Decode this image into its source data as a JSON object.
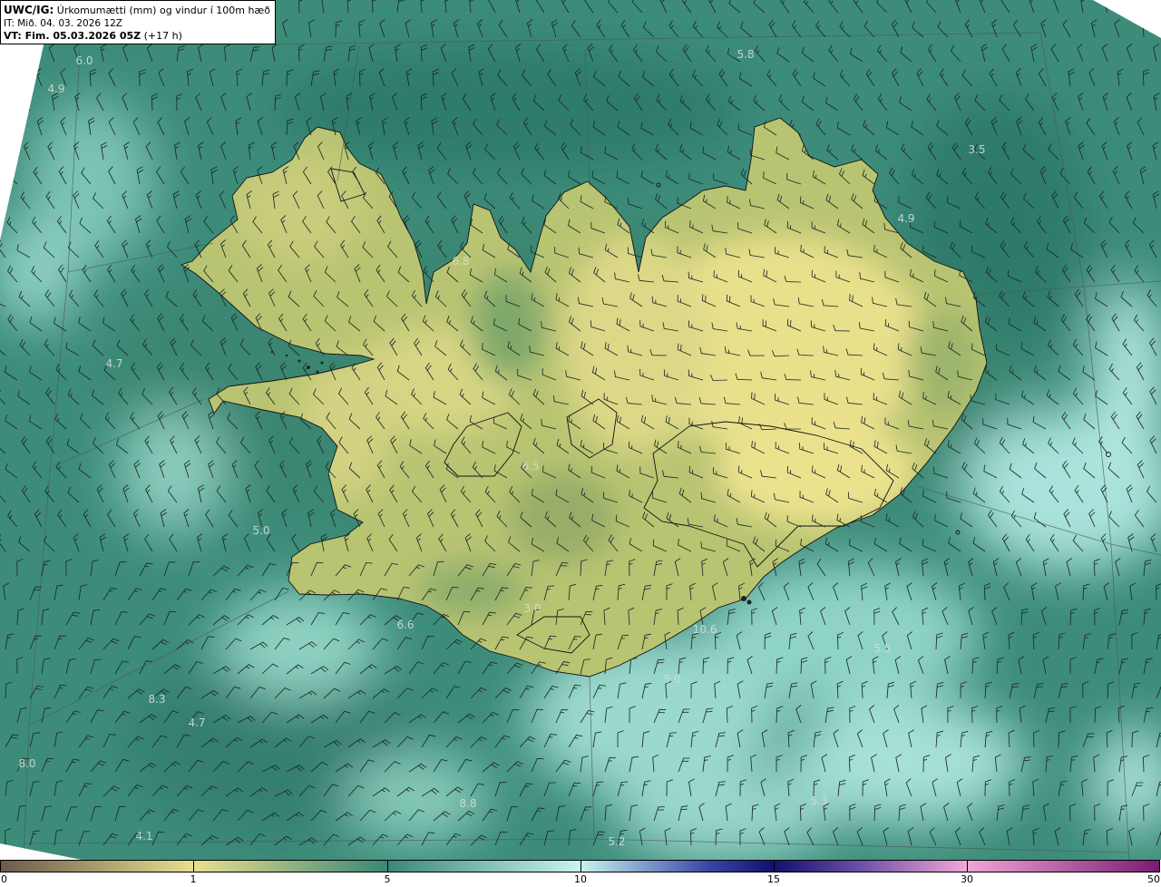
{
  "header": {
    "model": "UWC/IG:",
    "title": "Úrkomumætti (mm) og vindur í 100m hæð",
    "init_time": "IT: Mið. 04. 03. 2026 12Z",
    "valid_time": "VT: Fim. 05.03.2026 05Z",
    "lead_time": "(+17 h)"
  },
  "map_values": [
    "6.0",
    "4.9",
    "5.8",
    "3.5",
    "4.9",
    "6.8",
    "4.7",
    "6.5",
    "5.0",
    "3.0",
    "6.6",
    "10.6",
    "5.5",
    "5.0",
    "8.3",
    "4.7",
    "8.0",
    "8.8",
    "5.3",
    "4.1",
    "5.2"
  ],
  "colorbar": {
    "ticks": [
      "0",
      "1",
      "5",
      "10",
      "15",
      "30",
      "50"
    ],
    "colors": [
      "#6b5b4c",
      "#e9df8e",
      "#3a8876",
      "#c8f4f0",
      "#101070",
      "#f2a6d8",
      "#7a1c72"
    ]
  },
  "colors": {
    "sea": "#3d8c7a",
    "land": "#b9c472",
    "coastline": "#111111",
    "wind_barb": "#1c2a26"
  }
}
